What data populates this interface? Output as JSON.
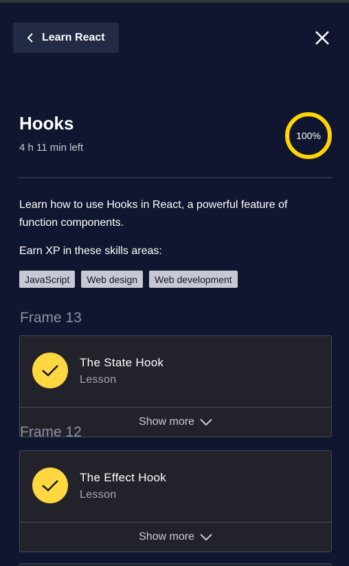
{
  "nav": {
    "back_label": "Learn React",
    "back_icon": "chevron-left-icon",
    "close_icon": "close-icon"
  },
  "header": {
    "title": "Hooks",
    "time_left": "4 h 11 min left",
    "progress": "100%",
    "progress_color": "#ffd500"
  },
  "description": "Learn how to use Hooks in React, a powerful feature of function components.",
  "skills": {
    "heading": "Earn XP in these skills areas:",
    "items": [
      "JavaScript",
      "Web design",
      "Web development"
    ]
  },
  "frames": [
    {
      "label": "Frame 13",
      "lesson_title": "The State Hook",
      "lesson_type": "Lesson",
      "completed": true,
      "show_more": "Show more"
    },
    {
      "label": "Frame 12",
      "lesson_title": "The Effect Hook",
      "lesson_type": "Lesson",
      "completed": true,
      "show_more": "Show more"
    }
  ],
  "colors": {
    "background": "#10162f",
    "check": "#ffd740"
  }
}
